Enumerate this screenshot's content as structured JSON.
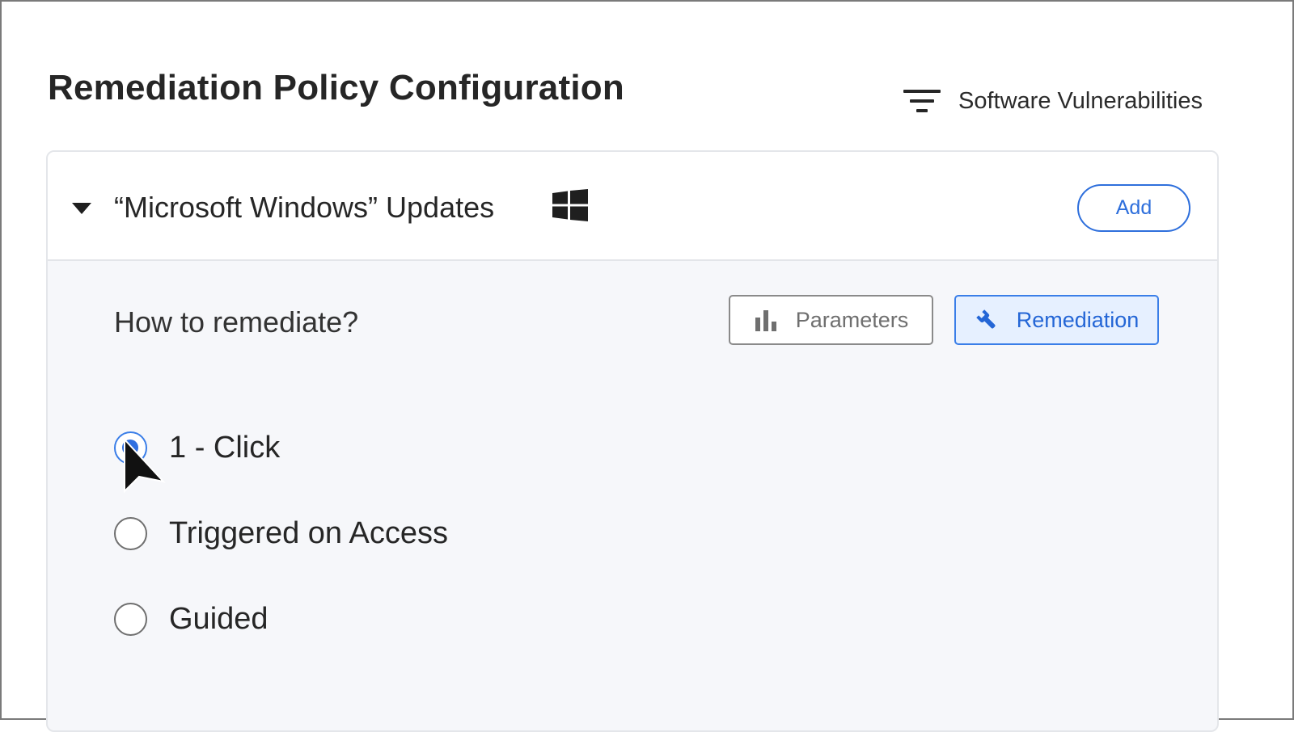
{
  "header": {
    "title": "Remediation Policy Configuration",
    "filter_label": "Software Vulnerabilities",
    "filter_icon": "filter-icon"
  },
  "section": {
    "title": "“Microsoft Windows” Updates",
    "os_icon": "windows-icon",
    "expanded": true,
    "add_label": "Add"
  },
  "remediate": {
    "question": "How to remediate?",
    "tabs": [
      {
        "label": "Parameters",
        "icon": "bar-chart-icon",
        "active": false
      },
      {
        "label": "Remediation",
        "icon": "wrench-icon",
        "active": true
      }
    ],
    "options": [
      {
        "label": "1 - Click",
        "checked": true
      },
      {
        "label": "Triggered on Access",
        "checked": false
      },
      {
        "label": "Guided",
        "checked": false
      }
    ]
  },
  "colors": {
    "accent": "#2e6fdc",
    "active_tab_bg": "#e6f0ff",
    "panel_bg": "#f6f7fa"
  }
}
